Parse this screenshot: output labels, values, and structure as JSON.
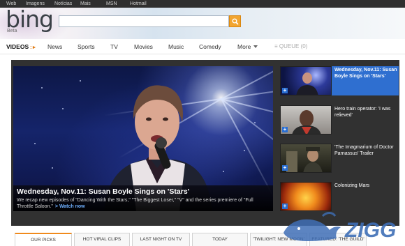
{
  "topnav": {
    "links": [
      "Web",
      "Imagens",
      "Notícias",
      "Mais",
      "MSN",
      "Hotmail"
    ]
  },
  "brand": {
    "logo": "bing",
    "sub": "Beta"
  },
  "search": {
    "value": "",
    "placeholder": ""
  },
  "catnav": {
    "active": "VIDEOS",
    "items": [
      "News",
      "Sports",
      "TV",
      "Movies",
      "Music",
      "Comedy",
      "More"
    ],
    "queue": "QUEUE (0)"
  },
  "hero": {
    "title": "Wednesday, Nov.11: Susan Boyle Sings on 'Stars'",
    "description": "We recap new episodes of \"Dancing With the Stars,\" \"The Biggest Loser,\" \"V\" and the series premiere of \"Full Throttle Saloon.\"",
    "watch_label": "> Watch now"
  },
  "side_items": [
    {
      "title": "Wednesday, Nov.11: Susan Boyle Sings on 'Stars'",
      "active": true
    },
    {
      "title": "Hero train operator: 'I was relieved'",
      "active": false
    },
    {
      "title": "'The Imagmarium of Doctor Parnassus' Trailer",
      "active": false
    },
    {
      "title": "Colonizing Mars",
      "active": false
    }
  ],
  "tabs": [
    "OUR PICKS",
    "HOT VIRAL CLIPS",
    "LAST NIGHT ON TV",
    "TODAY",
    "'TWILIGHT: NEW MOON'",
    "FEATURED: 'THE GUILD'"
  ],
  "watermark": "ZIGG",
  "colors": {
    "accent": "#f08a1c",
    "active_blue": "#2f6fd0",
    "stage": "#313131"
  }
}
